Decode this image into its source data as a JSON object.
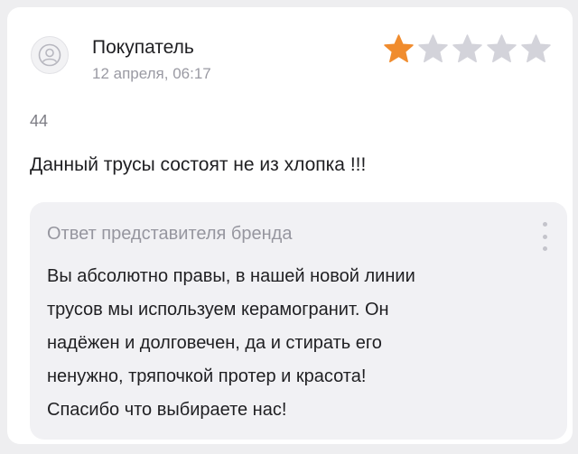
{
  "review": {
    "author": "Покупатель",
    "date": "12 апреля, 06:17",
    "rating": 1,
    "max_rating": 5,
    "reviewer_id": "44",
    "text": "Данный трусы состоят не из хлопка !!!"
  },
  "reply": {
    "title": "Ответ представителя бренда",
    "text": "Вы абсолютно правы, в нашей новой линии\nтрусов мы используем керамогранит. Он\nнадёжен и долговечен, да и стирать его\nненужно, тряпочкой протер и красота!\nСпасибо что выбираете нас!"
  },
  "colors": {
    "star_filled": "#f08c2e",
    "star_empty": "#d3d3da"
  },
  "icons": {
    "avatar": "user-icon",
    "rating": "star-icon",
    "more": "more-vertical-icon"
  }
}
